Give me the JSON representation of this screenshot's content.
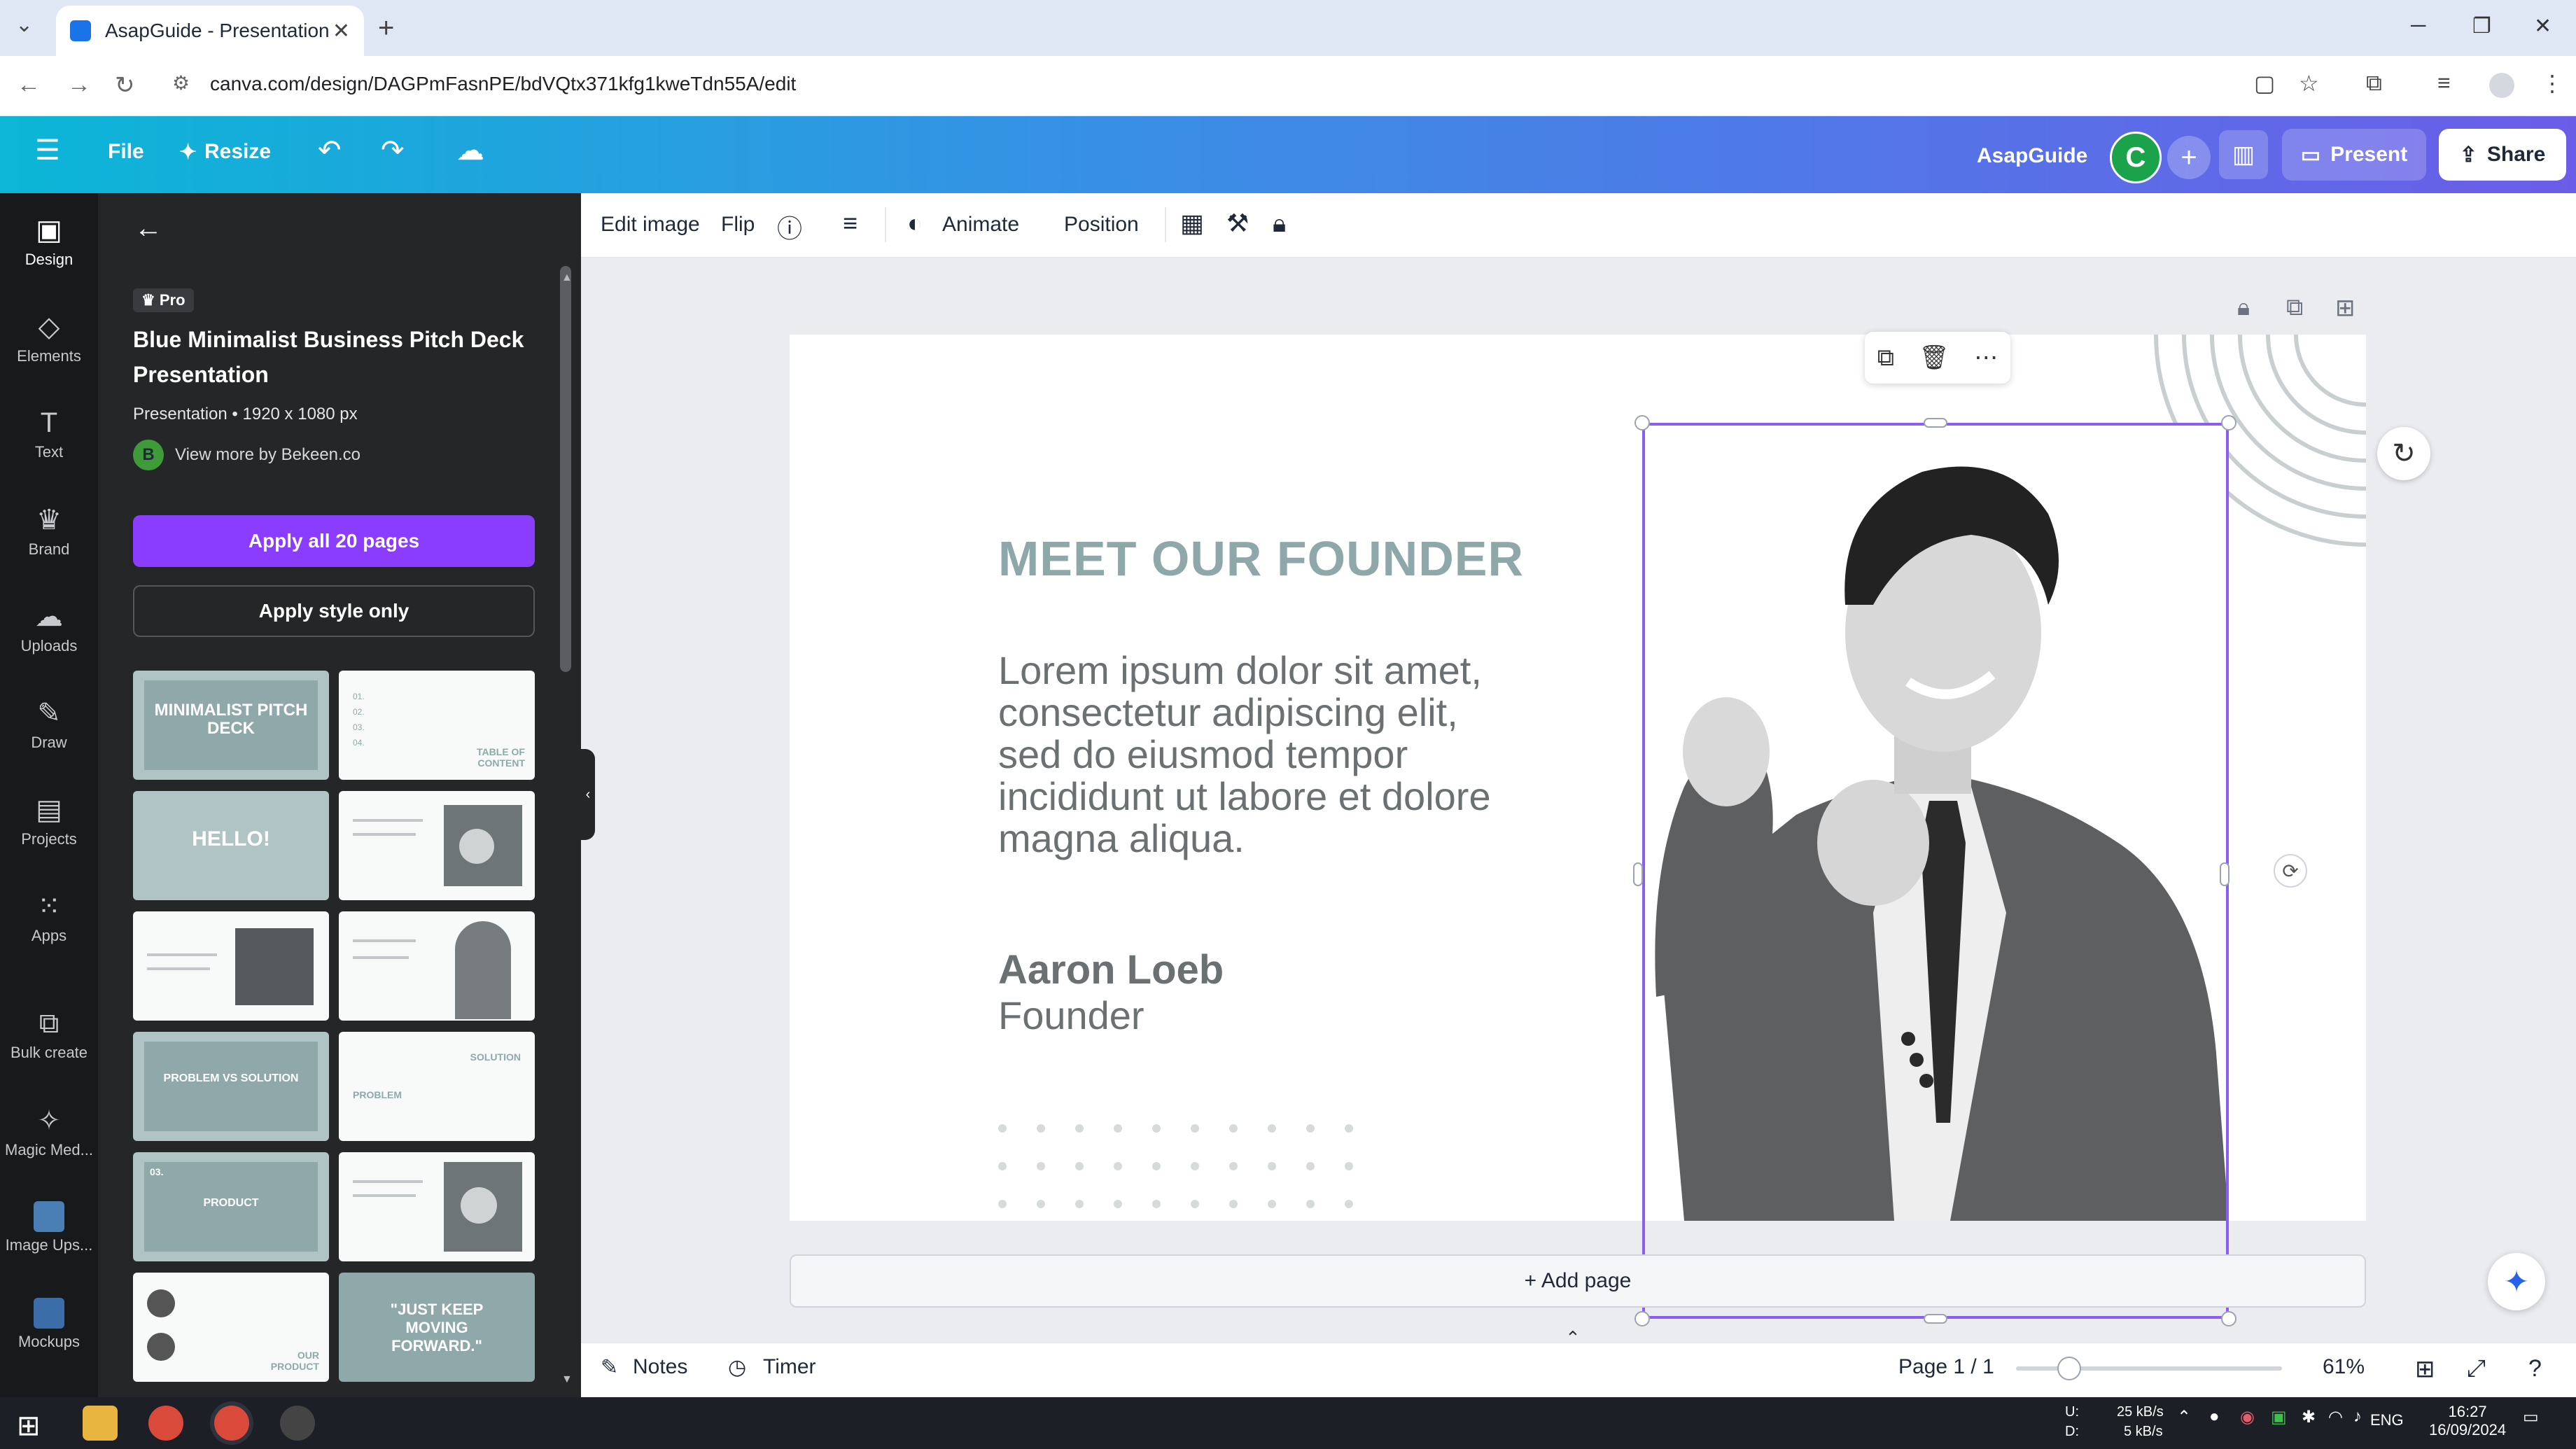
{
  "browser": {
    "tab_title": "AsapGuide - Presentation",
    "url": "canva.com/design/DAGPmFasnPE/bdVQtx371kfg1kweTdn55A/edit"
  },
  "topbar": {
    "file": "File",
    "resize": "Resize",
    "brand_name": "AsapGuide",
    "avatar_letter": "C",
    "present": "Present",
    "share": "Share"
  },
  "rail": {
    "items": [
      {
        "label": "Design",
        "icon": "design-icon"
      },
      {
        "label": "Elements",
        "icon": "elements-icon"
      },
      {
        "label": "Text",
        "icon": "text-icon"
      },
      {
        "label": "Brand",
        "icon": "brand-icon"
      },
      {
        "label": "Uploads",
        "icon": "uploads-icon"
      },
      {
        "label": "Draw",
        "icon": "draw-icon"
      },
      {
        "label": "Projects",
        "icon": "projects-icon"
      },
      {
        "label": "Apps",
        "icon": "apps-icon"
      },
      {
        "label": "Bulk create",
        "icon": "bulk-create-icon"
      },
      {
        "label": "Magic Med...",
        "icon": "magic-media-icon"
      },
      {
        "label": "Image Ups...",
        "icon": "image-upscaler-icon"
      },
      {
        "label": "Mockups",
        "icon": "mockups-icon"
      }
    ]
  },
  "panel": {
    "pro_badge": "Pro",
    "template_title": "Blue Minimalist Business Pitch Deck Presentation",
    "template_meta": "Presentation • 1920 x 1080 px",
    "author_initial": "B",
    "author_link": "View more by Bekeen.co",
    "apply_all": "Apply all 20 pages",
    "apply_style": "Apply style only",
    "thumbnails": {
      "t1": "MINIMALIST PITCH DECK",
      "t2": "TABLE OF CONTENT",
      "t2_items": [
        "01.",
        "02.",
        "03.",
        "04."
      ],
      "t3": "HELLO!",
      "t7": "PROBLEM VS SOLUTION",
      "t8a": "SOLUTION",
      "t8b": "PROBLEM",
      "t9_num": "03.",
      "t9": "PRODUCT",
      "t11": "OUR PRODUCT",
      "t12": "\"JUST KEEP MOVING FORWARD.\""
    }
  },
  "toolbar": {
    "edit_image": "Edit image",
    "flip": "Flip",
    "animate": "Animate",
    "position": "Position"
  },
  "slide": {
    "title": "MEET OUR FOUNDER",
    "body": "Lorem ipsum dolor sit amet, consectetur adipiscing elit, sed do eiusmod tempor incididunt ut labore et dolore magna aliqua.",
    "name": "Aaron Loeb",
    "role": "Founder"
  },
  "canvas": {
    "add_page": "+ Add page"
  },
  "footer": {
    "notes": "Notes",
    "timer": "Timer",
    "page": "Page 1 / 1",
    "zoom": "61%",
    "zoom_fraction": 0.2
  },
  "taskbar": {
    "net_up": "25 kB/s",
    "net_down": "5 kB/s",
    "net_u": "U:",
    "net_d": "D:",
    "lang": "ENG",
    "time": "16:27",
    "date": "16/09/2024"
  },
  "colors": {
    "accent": "#8b3dff",
    "selection": "#8b5cf6",
    "slide_title": "#8ea7a8"
  }
}
